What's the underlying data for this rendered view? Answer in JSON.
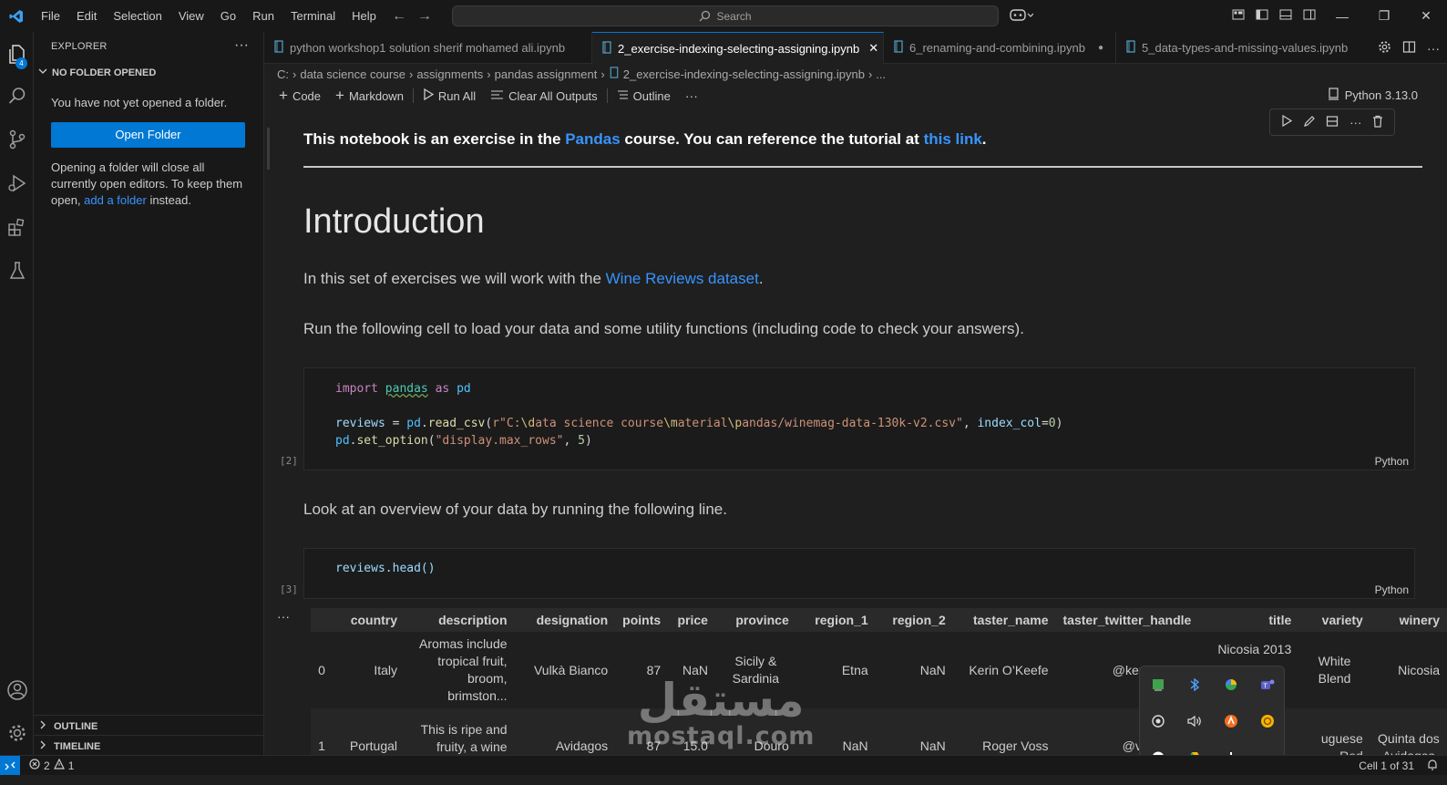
{
  "menu": [
    "File",
    "Edit",
    "Selection",
    "View",
    "Go",
    "Run",
    "Terminal",
    "Help"
  ],
  "search": {
    "label": "Search"
  },
  "activity": {
    "explorer_badge": "4"
  },
  "sidebar": {
    "title": "EXPLORER",
    "section": "NO FOLDER OPENED",
    "message": "You have not yet opened a folder.",
    "open_folder": "Open Folder",
    "note_part1": "Opening a folder will close all currently open editors. To keep them open, ",
    "note_link": "add a folder",
    "note_part2": " instead.",
    "outline": "OUTLINE",
    "timeline": "TIMELINE"
  },
  "tabs": [
    {
      "label": "python workshop1 solution sherif mohamed ali.ipynb"
    },
    {
      "label": "2_exercise-indexing-selecting-assigning.ipynb"
    },
    {
      "label": "6_renaming-and-combining.ipynb"
    },
    {
      "label": "5_data-types-and-missing-values.ipynb"
    }
  ],
  "breadcrumbs": [
    "C:",
    "data science course",
    "assignments",
    "pandas assignment",
    "2_exercise-indexing-selecting-assigning.ipynb",
    "..."
  ],
  "toolbar": {
    "code": "Code",
    "markdown": "Markdown",
    "run_all": "Run All",
    "clear": "Clear All Outputs",
    "outline": "Outline"
  },
  "kernel": "Python 3.13.0",
  "notebook": {
    "intro_pre": "This notebook is an exercise in the ",
    "intro_link1": "Pandas",
    "intro_mid": " course. You can reference the tutorial at ",
    "intro_link2": "this link",
    "intro_end": ".",
    "heading": "Introduction",
    "p1_pre": "In this set of exercises we will work with the ",
    "p1_link": "Wine Reviews dataset",
    "p1_end": ".",
    "p2": "Run the following cell to load your data and some utility functions (including code to check your answers).",
    "cell1_exec": "[2]",
    "cell1_lang": "Python",
    "p3": "Look at an overview of your data by running the following line.",
    "cell2_exec": "[3]",
    "cell2_lang": "Python",
    "cell2_code": "reviews.head()"
  },
  "table": {
    "columns": [
      "",
      "country",
      "description",
      "designation",
      "points",
      "price",
      "province",
      "region_1",
      "region_2",
      "taster_name",
      "taster_twitter_handle",
      "title",
      "variety",
      "winery"
    ],
    "rows": [
      [
        "0",
        "Italy",
        "Aromas include tropical fruit, broom, brimston...",
        "Vulkà Bianco",
        "87",
        "NaN",
        "Sicily & Sardinia",
        "Etna",
        "NaN",
        "Kerin O’Keefe",
        "@kerinokeefe",
        "Nicosia 2013",
        "White Blend",
        "Nicosia"
      ],
      [
        "1",
        "Portugal",
        "This is ripe and fruity, a wine",
        "Avidagos",
        "87",
        "15.0",
        "Douro",
        "NaN",
        "NaN",
        "Roger Voss",
        "@vossroger",
        "",
        "uguese Red",
        "Quinta dos Avidagos"
      ]
    ]
  },
  "watermark": {
    "arabic": "مستقل",
    "latin": "mostaql.com"
  },
  "status": {
    "errors": "2",
    "warnings": "1",
    "cell": "Cell 1 of 31"
  }
}
